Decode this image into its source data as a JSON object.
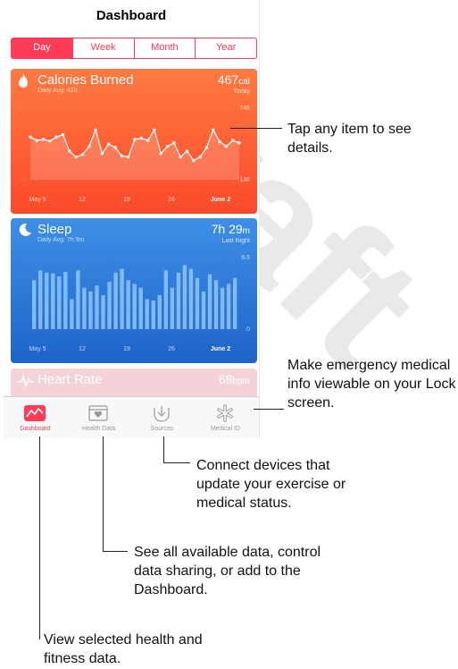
{
  "header": {
    "title": "Dashboard"
  },
  "segments": [
    "Day",
    "Week",
    "Month",
    "Year"
  ],
  "calories": {
    "title": "Calories Burned",
    "sub": "Daily Avg: 428",
    "value": "467",
    "unit": "cal",
    "note": "Today",
    "ymax": "745",
    "ymin": "136",
    "xlabels": [
      "May 5",
      "12",
      "19",
      "26",
      "June 2"
    ],
    "series": [
      500,
      470,
      480,
      465,
      500,
      520,
      380,
      330,
      350,
      420,
      560,
      360,
      440,
      410,
      340,
      330,
      480,
      490,
      470,
      560,
      360,
      420,
      450,
      330,
      380,
      300,
      330,
      410,
      560,
      460,
      420,
      470,
      450
    ]
  },
  "sleep": {
    "title": "Sleep",
    "sub": "Daily Avg: 7h 9m",
    "value": "7h 29",
    "unit": "m",
    "note": "Last Night",
    "ymax": "9.5",
    "ymin": "0",
    "xlabels": [
      "May 5",
      "12",
      "19",
      "26",
      "June 2"
    ],
    "bars": [
      6.5,
      7.8,
      7.5,
      7.4,
      7.0,
      7.6,
      4.0,
      7.8,
      5.5,
      5.0,
      5.8,
      4.5,
      6.3,
      7.5,
      8.0,
      6.5,
      6.0,
      5.5,
      4.0,
      3.8,
      4.5,
      7.8,
      5.5,
      7.5,
      8.5,
      8.0,
      6.8,
      5.0,
      7.3,
      6.5,
      5.5,
      6.0,
      6.8
    ]
  },
  "heart": {
    "title": "Heart Rate",
    "value": "68",
    "unit": "bpm"
  },
  "tabs": [
    {
      "label": "Dashboard"
    },
    {
      "label": "Health Data"
    },
    {
      "label": "Sources"
    },
    {
      "label": "Medical ID"
    }
  ],
  "callouts": {
    "tap": "Tap any item to see details.",
    "emergency": "Make emergency medical info viewable on your Lock screen.",
    "connect": "Connect devices that update your exercise or medical status.",
    "seeall": "See all available data, control data sharing, or add to the Dashboard.",
    "view": "View selected health and fitness data."
  },
  "watermark": "Draft",
  "colors": {
    "accent": "#ff3b58",
    "calories": "#fb4a2a",
    "sleep": "#2a72d6"
  }
}
